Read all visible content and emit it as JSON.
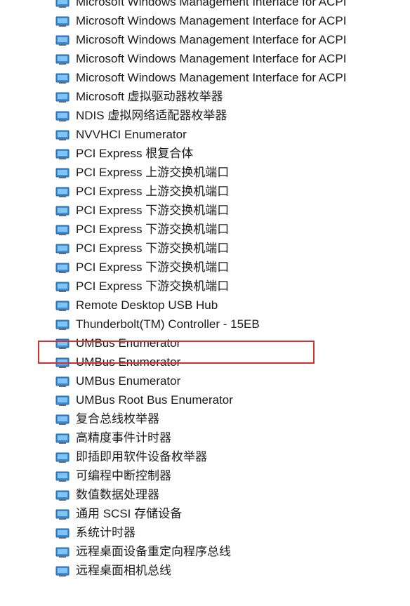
{
  "device_manager": {
    "items": [
      {
        "label": "Microsoft Windows Management Interface for ACPI",
        "icon": "system-device-icon"
      },
      {
        "label": "Microsoft Windows Management Interface for ACPI",
        "icon": "system-device-icon"
      },
      {
        "label": "Microsoft Windows Management Interface for ACPI",
        "icon": "system-device-icon"
      },
      {
        "label": "Microsoft Windows Management Interface for ACPI",
        "icon": "system-device-icon"
      },
      {
        "label": "Microsoft Windows Management Interface for ACPI",
        "icon": "system-device-icon"
      },
      {
        "label": "Microsoft 虚拟驱动器枚举器",
        "icon": "system-device-icon"
      },
      {
        "label": "NDIS 虚拟网络适配器枚举器",
        "icon": "system-device-icon"
      },
      {
        "label": "NVVHCI Enumerator",
        "icon": "system-device-icon"
      },
      {
        "label": "PCI Express 根复合体",
        "icon": "system-device-icon"
      },
      {
        "label": "PCI Express 上游交换机端口",
        "icon": "system-device-icon"
      },
      {
        "label": "PCI Express 上游交换机端口",
        "icon": "system-device-icon"
      },
      {
        "label": "PCI Express 下游交换机端口",
        "icon": "system-device-icon"
      },
      {
        "label": "PCI Express 下游交换机端口",
        "icon": "system-device-icon"
      },
      {
        "label": "PCI Express 下游交换机端口",
        "icon": "system-device-icon"
      },
      {
        "label": "PCI Express 下游交换机端口",
        "icon": "system-device-icon"
      },
      {
        "label": "PCI Express 下游交换机端口",
        "icon": "system-device-icon"
      },
      {
        "label": "Remote Desktop USB Hub",
        "icon": "system-device-icon"
      },
      {
        "label": "Thunderbolt(TM) Controller - 15EB",
        "icon": "system-device-icon"
      },
      {
        "label": "UMBus Enumerator",
        "icon": "system-device-icon"
      },
      {
        "label": "UMBus Enumerator",
        "icon": "system-device-icon"
      },
      {
        "label": "UMBus Enumerator",
        "icon": "system-device-icon"
      },
      {
        "label": "UMBus Root Bus Enumerator",
        "icon": "system-device-icon"
      },
      {
        "label": "复合总线枚举器",
        "icon": "system-device-icon"
      },
      {
        "label": "高精度事件计时器",
        "icon": "system-device-icon"
      },
      {
        "label": "即插即用软件设备枚举器",
        "icon": "system-device-icon"
      },
      {
        "label": "可编程中断控制器",
        "icon": "system-device-icon"
      },
      {
        "label": "数值数据处理器",
        "icon": "system-device-icon"
      },
      {
        "label": "通用 SCSI 存储设备",
        "icon": "system-device-icon"
      },
      {
        "label": "系统计时器",
        "icon": "system-device-icon"
      },
      {
        "label": "远程桌面设备重定向程序总线",
        "icon": "system-device-icon"
      },
      {
        "label": "远程桌面相机总线",
        "icon": "system-device-icon"
      }
    ],
    "highlight": {
      "color": "#d32f2f"
    }
  }
}
